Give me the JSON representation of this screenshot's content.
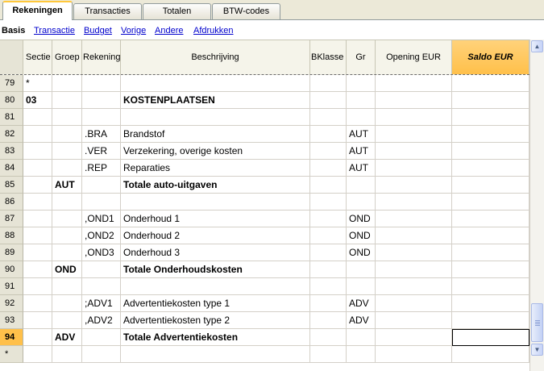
{
  "tabs": [
    {
      "label": "Rekeningen",
      "active": true
    },
    {
      "label": "Transacties",
      "active": false
    },
    {
      "label": "Totalen",
      "active": false
    },
    {
      "label": "BTW-codes",
      "active": false
    }
  ],
  "views": [
    {
      "label": "Basis",
      "active": true
    },
    {
      "label": "Transactie",
      "active": false
    },
    {
      "label": "Budget",
      "active": false
    },
    {
      "label": "Vorige",
      "active": false
    },
    {
      "label": "Andere",
      "active": false
    },
    {
      "label": "Afdrukken",
      "active": false
    }
  ],
  "columns": {
    "sectie": "Sectie",
    "groep": "Groep",
    "rekening": "Rekening",
    "beschrijving": "Beschrijving",
    "bklasse": "BKlasse",
    "gr": "Gr",
    "opening": "Opening EUR",
    "saldo": "Saldo EUR"
  },
  "rows": [
    {
      "num": "79",
      "sectie": "*",
      "groep": "",
      "rekening": "",
      "beschrijving": "",
      "bklasse": "",
      "gr": "",
      "style": "normal"
    },
    {
      "num": "80",
      "sectie": "03",
      "groep": "",
      "rekening": "",
      "beschrijving": "KOSTENPLAATSEN",
      "bklasse": "",
      "gr": "",
      "style": "bold"
    },
    {
      "num": "81",
      "sectie": "",
      "groep": "",
      "rekening": "",
      "beschrijving": "",
      "bklasse": "",
      "gr": "",
      "style": "normal"
    },
    {
      "num": "82",
      "sectie": "",
      "groep": "",
      "rekening": ".BRA",
      "beschrijving": "Brandstof",
      "bklasse": "",
      "gr": "AUT",
      "style": "normal"
    },
    {
      "num": "83",
      "sectie": "",
      "groep": "",
      "rekening": ".VER",
      "beschrijving": "Verzekering, overige kosten",
      "bklasse": "",
      "gr": "AUT",
      "style": "normal"
    },
    {
      "num": "84",
      "sectie": "",
      "groep": "",
      "rekening": ".REP",
      "beschrijving": "Reparaties",
      "bklasse": "",
      "gr": "AUT",
      "style": "normal"
    },
    {
      "num": "85",
      "sectie": "",
      "groep": "AUT",
      "rekening": "",
      "beschrijving": "Totale auto-uitgaven",
      "bklasse": "",
      "gr": "",
      "style": "bold"
    },
    {
      "num": "86",
      "sectie": "",
      "groep": "",
      "rekening": "",
      "beschrijving": "",
      "bklasse": "",
      "gr": "",
      "style": "normal"
    },
    {
      "num": "87",
      "sectie": "",
      "groep": "",
      "rekening": ",OND1",
      "beschrijving": "Onderhoud 1",
      "bklasse": "",
      "gr": "OND",
      "style": "normal"
    },
    {
      "num": "88",
      "sectie": "",
      "groep": "",
      "rekening": ",OND2",
      "beschrijving": "Onderhoud 2",
      "bklasse": "",
      "gr": "OND",
      "style": "normal"
    },
    {
      "num": "89",
      "sectie": "",
      "groep": "",
      "rekening": ",OND3",
      "beschrijving": "Onderhoud 3",
      "bklasse": "",
      "gr": "OND",
      "style": "normal"
    },
    {
      "num": "90",
      "sectie": "",
      "groep": "OND",
      "rekening": "",
      "beschrijving": "Totale Onderhoudskosten",
      "bklasse": "",
      "gr": "",
      "style": "bold"
    },
    {
      "num": "91",
      "sectie": "",
      "groep": "",
      "rekening": "",
      "beschrijving": "",
      "bklasse": "",
      "gr": "",
      "style": "normal"
    },
    {
      "num": "92",
      "sectie": "",
      "groep": "",
      "rekening": ";ADV1",
      "beschrijving": "Advertentiekosten type 1",
      "bklasse": "",
      "gr": "ADV",
      "style": "normal"
    },
    {
      "num": "93",
      "sectie": "",
      "groep": "",
      "rekening": ",ADV2",
      "beschrijving": "Advertentiekosten type 2",
      "bklasse": "",
      "gr": "ADV",
      "style": "normal"
    },
    {
      "num": "94",
      "sectie": "",
      "groep": "ADV",
      "rekening": "",
      "beschrijving": "Totale Advertentiekosten",
      "bklasse": "",
      "gr": "",
      "style": "bold",
      "active": true
    },
    {
      "num": "*",
      "sectie": "",
      "groep": "",
      "rekening": "",
      "beschrijving": "",
      "bklasse": "",
      "gr": "",
      "style": "new"
    }
  ],
  "icons": {
    "scroll_up": "arrow-up-icon",
    "scroll_down": "arrow-down-icon"
  },
  "colors": {
    "active_tab_accent": "#ffc83c",
    "saldo_header": "#ffc04a",
    "active_row_number": "#ffc04a",
    "link": "#0000cc",
    "row_number_bg": "#e6e4d6"
  }
}
